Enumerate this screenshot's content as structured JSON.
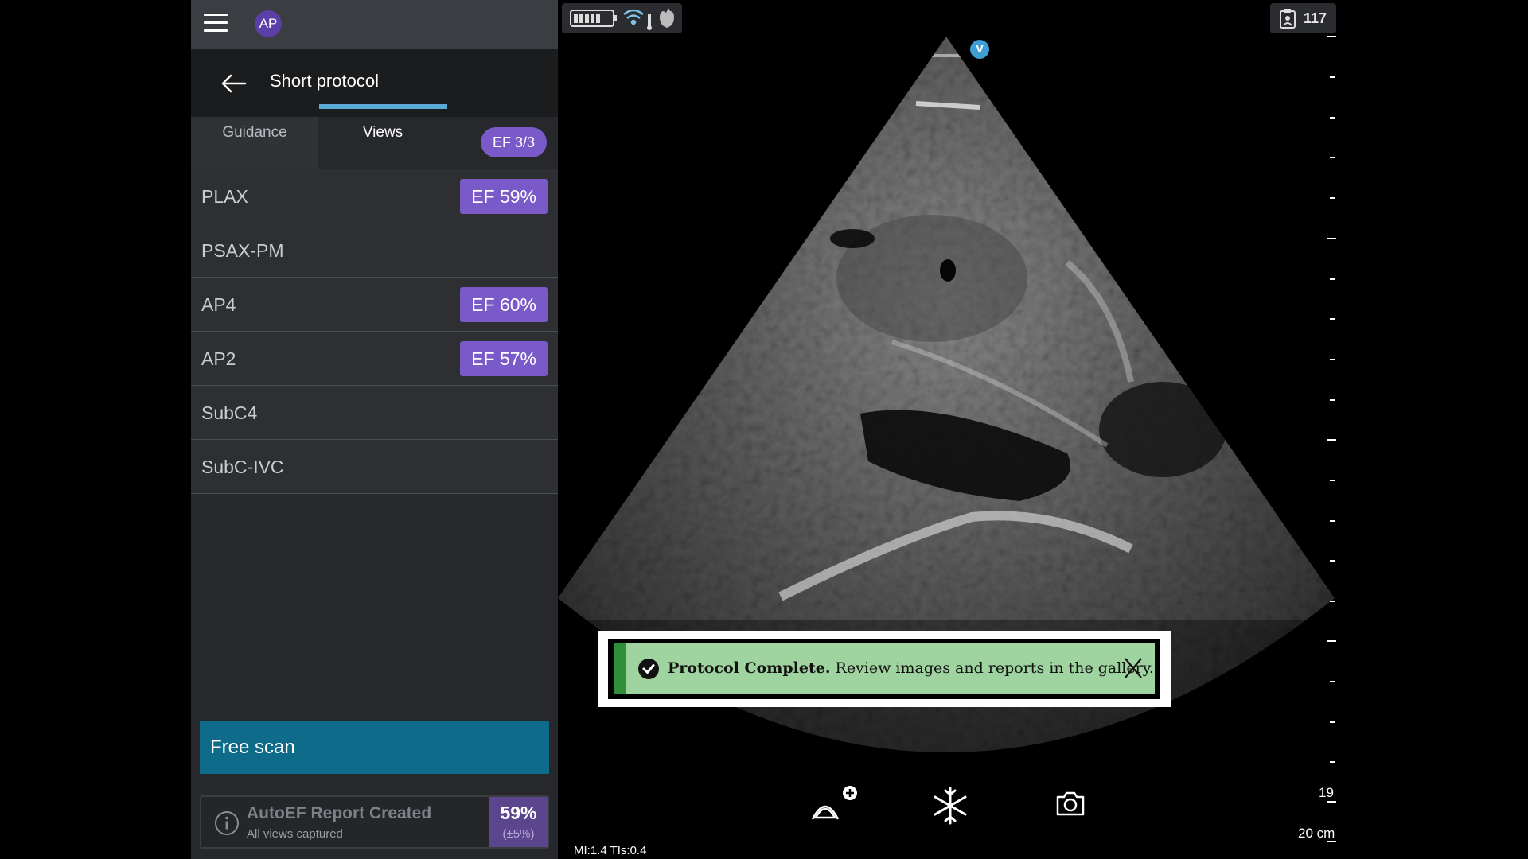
{
  "topbar": {
    "avatar_initials": "AP"
  },
  "header": {
    "title": "Short protocol"
  },
  "tabs": [
    {
      "label": "Guidance",
      "active": false
    },
    {
      "label": "Views",
      "active": true
    }
  ],
  "ef_count_badge": "EF 3/3",
  "views": [
    {
      "label": "PLAX",
      "ef": "EF 59%"
    },
    {
      "label": "PSAX-PM",
      "ef": ""
    },
    {
      "label": "AP4",
      "ef": "EF 60%"
    },
    {
      "label": "AP2",
      "ef": "EF 57%"
    },
    {
      "label": "SubC4",
      "ef": ""
    },
    {
      "label": "SubC-IVC",
      "ef": ""
    }
  ],
  "free_scan_label": "Free scan",
  "autoef": {
    "title": "AutoEF Report Created",
    "subtitle": "All views captured",
    "value": "59%",
    "tolerance": "(±5%)"
  },
  "scan": {
    "patient_counter": "117",
    "orientation_marker": "V",
    "depth_label_19": "19",
    "depth_label_20": "20 cm",
    "mi_tis": "MI:1.4  TIs:0.4"
  },
  "toast": {
    "bold": "Protocol Complete.",
    "message": " Review images and reports in the gallery.",
    "close": "X"
  },
  "colors": {
    "accent_purple": "#7a5ac8",
    "free_scan_teal": "#0f6b8a",
    "toast_green": "#9fd39f",
    "tab_indicator": "#5aa9d6"
  }
}
